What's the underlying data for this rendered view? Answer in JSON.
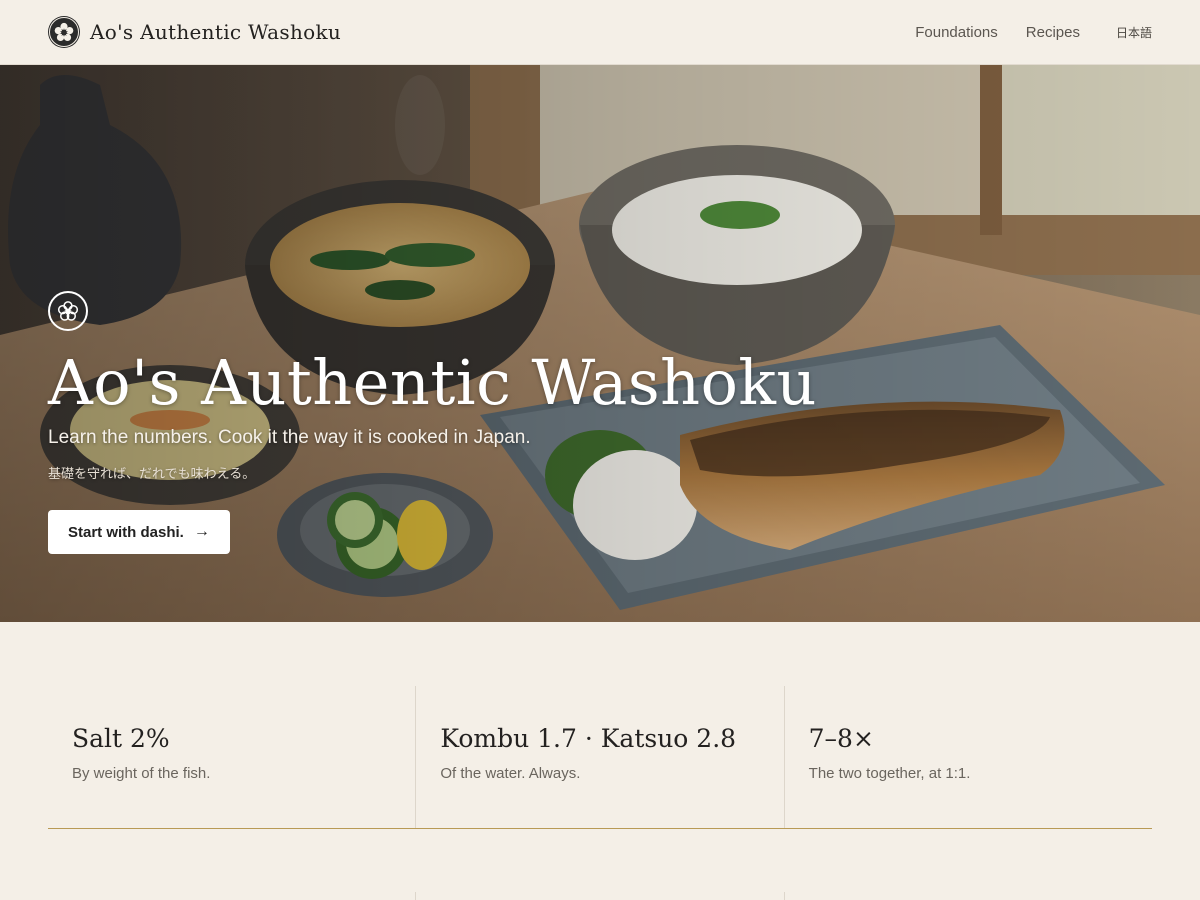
{
  "site": {
    "brand_name": "Ao's Authentic Washoku",
    "logo_icon": "plum-blossom-crest-icon"
  },
  "nav": {
    "items": [
      {
        "label": "Foundations"
      },
      {
        "label": "Recipes"
      }
    ],
    "language_label": "日本語"
  },
  "hero": {
    "crest_icon": "plum-blossom-crest-icon",
    "title": "Ao's Authentic Washoku",
    "subtitle": "Learn the numbers. Cook it the way it is cooked in Japan.",
    "subtitle_jp": "基礎を守れば、だれでも味わえる。",
    "cta_label": "Start with dashi.",
    "cta_icon": "arrow-right-icon",
    "cta_arrow": "→"
  },
  "stats": [
    {
      "value": "Salt 2%",
      "caption": "By weight of the fish."
    },
    {
      "value": "Kombu 1.7 · Katsuo 2.8",
      "caption": "Of the water. Always."
    },
    {
      "value": "7–8×",
      "caption": "The two together, at 1:1."
    }
  ],
  "colors": {
    "page_background": "#f4efe7",
    "accent_rule": "#b89a55",
    "crest_dark": "#2b2b2b"
  }
}
